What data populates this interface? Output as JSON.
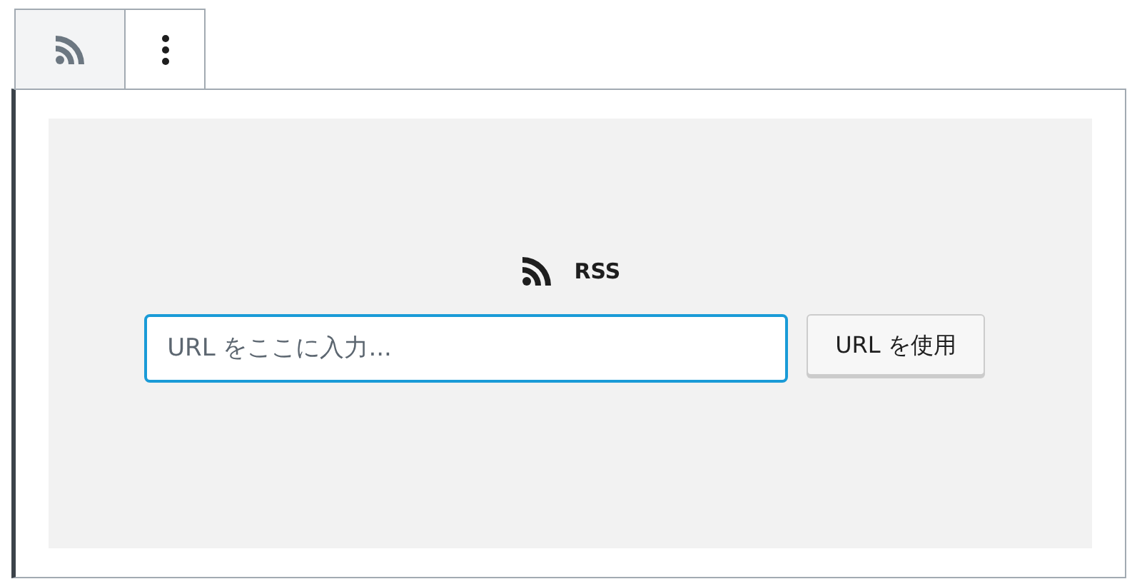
{
  "toolbar": [
    {
      "kind": "block-type",
      "selected": true
    },
    {
      "kind": "more",
      "selected": false
    }
  ],
  "placeholder": {
    "label": "RSS",
    "url_field": {
      "placeholder": "URL をここに入力...",
      "focused": true
    },
    "button": "URL を使用"
  }
}
